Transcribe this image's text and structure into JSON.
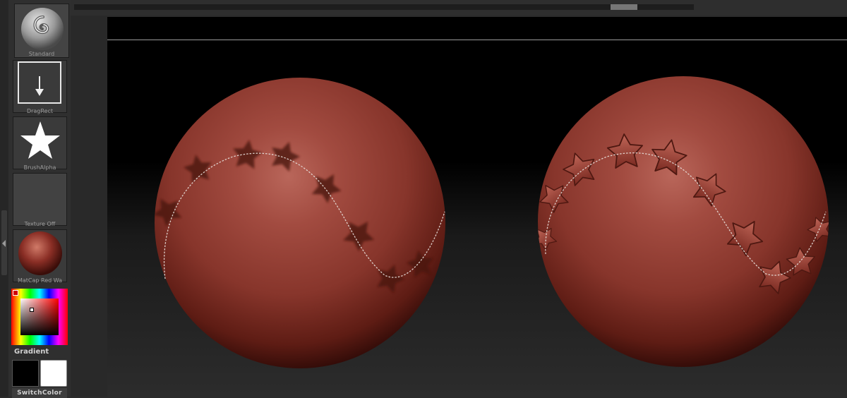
{
  "shelf": {
    "brush_label": "Standard",
    "stroke_label": "DragRect",
    "alpha_label": "BrushAlpha",
    "texture_label": "Texture Off",
    "material_label": "MatCap Red Wa",
    "gradient_label": "Gradient",
    "switchcolor_label": "SwitchColor"
  },
  "colors": {
    "main_color": "#000000",
    "secondary_color": "#ffffff",
    "material": "#8a2e25"
  },
  "icons": {
    "brush": "swirl-sphere-icon",
    "stroke": "drag-rect-arrow-icon",
    "alpha": "star-icon"
  }
}
